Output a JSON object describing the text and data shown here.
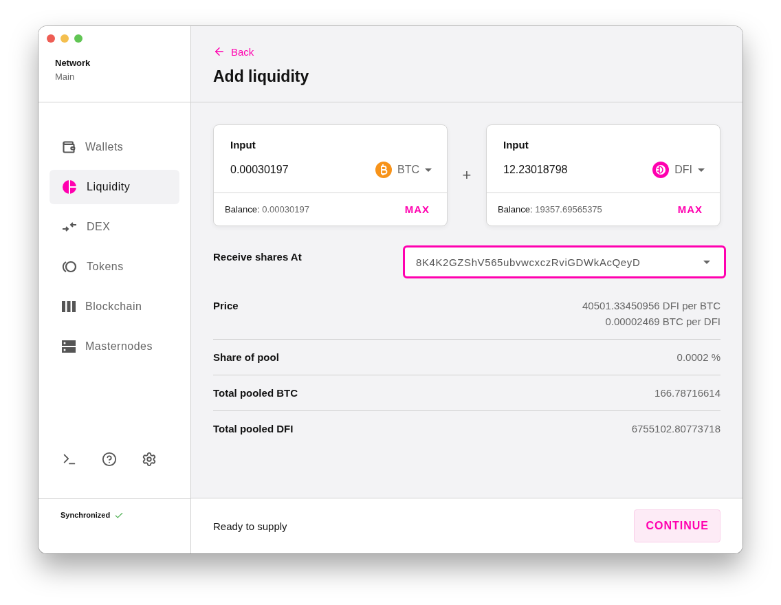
{
  "sidebar": {
    "network_label": "Network",
    "network_value": "Main",
    "items": [
      {
        "label": "Wallets",
        "selected": false
      },
      {
        "label": "Liquidity",
        "selected": true
      },
      {
        "label": "DEX",
        "selected": false
      },
      {
        "label": "Tokens",
        "selected": false
      },
      {
        "label": "Blockchain",
        "selected": false
      },
      {
        "label": "Masternodes",
        "selected": false
      }
    ],
    "status": "Synchronized",
    "synced": true
  },
  "header": {
    "back": "Back",
    "title": "Add liquidity"
  },
  "inputs": [
    {
      "label": "Input",
      "value": "0.00030197",
      "token": "BTC",
      "color": "#f7931a",
      "balance_label": "Balance:",
      "balance": "0.00030197",
      "max": "MAX"
    },
    {
      "label": "Input",
      "value": "12.23018798",
      "token": "DFI",
      "color": "#ff00af",
      "balance_label": "Balance:",
      "balance": "19357.69565375",
      "max": "MAX"
    }
  ],
  "plus": "+",
  "receive": {
    "label": "Receive shares At",
    "address": "8K4K2GZShV565ubvwcxczRviGDWkAcQeyD",
    "focused": true
  },
  "details": [
    {
      "label": "Price",
      "values": [
        "40501.33450956 DFI per BTC",
        "0.00002469 BTC per DFI"
      ]
    },
    {
      "label": "Share of pool",
      "values": [
        "0.0002 %"
      ]
    },
    {
      "label": "Total pooled BTC",
      "values": [
        "166.78716614"
      ]
    },
    {
      "label": "Total pooled DFI",
      "values": [
        "6755102.80773718"
      ]
    }
  ],
  "footer": {
    "status": "Ready to supply",
    "button": "CONTINUE"
  }
}
